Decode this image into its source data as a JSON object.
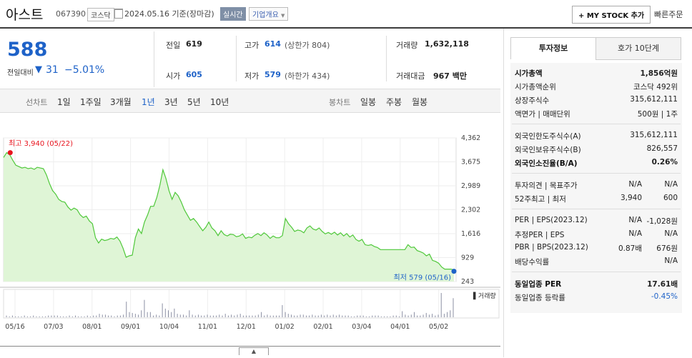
{
  "header": {
    "name": "아스트",
    "code": "067390",
    "market": "코스닥",
    "date_text": "2024.05.16 기준(장마감)",
    "realtime": "실시간",
    "company_overview": "기업개요",
    "my_stock_label": "+ MY STOCK 추가",
    "quick_order": "빠른주문"
  },
  "price": {
    "current": "588",
    "change_label": "전일대비",
    "change_arrow": "▼",
    "change_value": "31",
    "change_pct": "−5.01%"
  },
  "stats": {
    "prev_label": "전일",
    "prev": "619",
    "high_label": "고가",
    "high": "614",
    "upper_limit": "(상한가 804)",
    "volume_label": "거래량",
    "volume": "1,632,118",
    "open_label": "시가",
    "open": "605",
    "low_label": "저가",
    "low": "579",
    "lower_limit": "(하한가 434)",
    "amount_label": "거래대금",
    "amount": "967 백만"
  },
  "tabs": {
    "line_chart": "선차트",
    "periods": [
      "1일",
      "1주일",
      "3개월",
      "1년",
      "3년",
      "5년",
      "10년"
    ],
    "active_period": "1년",
    "candle_chart": "봉차트",
    "candle_periods": [
      "일봉",
      "주봉",
      "월봉"
    ]
  },
  "chart_data": {
    "type": "line",
    "y_ticks": [
      "4,362",
      "3,675",
      "2,989",
      "2,302",
      "1,616",
      "929",
      "243"
    ],
    "x_labels": [
      "05/16",
      "07/03",
      "08/01",
      "09/01",
      "10/04",
      "11/01",
      "12/01",
      "01/02",
      "02/01",
      "03/04",
      "04/01",
      "05/02"
    ],
    "max_label": "최고 3,940 (05/22)",
    "min_label": "최저 579 (05/16)",
    "volume_label": "거래량",
    "line_color": "#4fc83a",
    "fill_color": "#dff5d6",
    "ylim": [
      243,
      4362
    ],
    "values": [
      3800,
      3940,
      3880,
      3720,
      3580,
      3540,
      3500,
      3520,
      3480,
      3500,
      3460,
      3520,
      3500,
      3480,
      3300,
      3050,
      2850,
      2750,
      2600,
      2540,
      2520,
      2380,
      2290,
      2350,
      2300,
      2160,
      2080,
      2120,
      1980,
      1900,
      1500,
      1350,
      1460,
      1420,
      1440,
      1480,
      1460,
      1520,
      1400,
      1200,
      940,
      980,
      1000,
      1500,
      1750,
      1620,
      1950,
      2150,
      2400,
      2400,
      2650,
      3000,
      3450,
      3200,
      2850,
      2600,
      2800,
      2700,
      2520,
      2300,
      2150,
      2000,
      2050,
      1950,
      1820,
      1700,
      1800,
      1950,
      1780,
      1700,
      1560,
      1700,
      1590,
      1550,
      1600,
      1590,
      1530,
      1550,
      1610,
      1480,
      1520,
      1500,
      1570,
      1620,
      1560,
      1640,
      1580,
      1480,
      1550,
      1500,
      1500,
      1560,
      2050,
      1900,
      1800,
      1680,
      1720,
      1700,
      1640,
      1780,
      1840,
      1750,
      1720,
      1780,
      1680,
      1610,
      1650,
      1600,
      1660,
      1580,
      1640,
      1550,
      1620,
      1520,
      1580,
      1450,
      1400,
      1450,
      1300,
      1280,
      1300,
      1250,
      1220,
      1160,
      1160,
      1160,
      1160,
      1160,
      1160,
      1160,
      1160,
      1160,
      1300,
      1220,
      1230,
      1130,
      1100,
      1060,
      980,
      1030,
      850,
      820,
      770,
      660,
      600,
      600,
      600,
      579
    ]
  },
  "volume_data": {
    "values": [
      2,
      1,
      2,
      1,
      1,
      1,
      2,
      1,
      1,
      2,
      1,
      1,
      1,
      1,
      2,
      2,
      2,
      2,
      1,
      1,
      1,
      2,
      1,
      2,
      1,
      1,
      1,
      2,
      1,
      2,
      2,
      4,
      3,
      3,
      2,
      2,
      1,
      2,
      2,
      3,
      18,
      6,
      5,
      4,
      3,
      8,
      20,
      6,
      6,
      2,
      3,
      2,
      16,
      10,
      8,
      6,
      10,
      4,
      3,
      3,
      2,
      8,
      3,
      2,
      3,
      2,
      2,
      3,
      2,
      2,
      2,
      3,
      2,
      4,
      2,
      3,
      2,
      3,
      4,
      2,
      2,
      2,
      2,
      2,
      3,
      6,
      2,
      3,
      2,
      2,
      2,
      2,
      14,
      6,
      4,
      3,
      2,
      2,
      3,
      3,
      2,
      2,
      3,
      2,
      2,
      3,
      2,
      3,
      2,
      3,
      2,
      3,
      2,
      2,
      2,
      1,
      1,
      2,
      2,
      2,
      1,
      1,
      2,
      2,
      2,
      1,
      1,
      1,
      1,
      2,
      2,
      1,
      7,
      3,
      2,
      3,
      6,
      2,
      2,
      3,
      5,
      3,
      4,
      2,
      3,
      28,
      4,
      6,
      8,
      22
    ]
  },
  "info": {
    "tab_active": "투자정보",
    "tab_other": "호가 10단계",
    "rows1": [
      {
        "label": "시가총액",
        "value": "1,856억원"
      },
      {
        "label": "시가총액순위",
        "value": "코스닥 492위"
      },
      {
        "label": "상장주식수",
        "value": "315,612,111"
      },
      {
        "label": "액면가 | 매매단위",
        "value": "500원 | 1주"
      }
    ],
    "rows2": [
      {
        "label": "외국인한도주식수(A)",
        "value": "315,612,111"
      },
      {
        "label": "외국인보유주식수(B)",
        "value": "826,557"
      },
      {
        "label": "외국인소진율(B/A)",
        "value": "0.26%"
      }
    ],
    "rows3": [
      {
        "label": "투자의견 | 목표주가",
        "v1": "N/A",
        "v2": "N/A"
      },
      {
        "label": "52주최고 | 최저",
        "v1": "3,940",
        "v2": "600"
      }
    ],
    "rows4": [
      {
        "label": "PER | EPS(2023.12)",
        "v1": "N/A",
        "v2": "-1,028원"
      },
      {
        "label": "추정PER | EPS",
        "v1": "N/A",
        "v2": "N/A"
      },
      {
        "label": "PBR | BPS(2023.12)",
        "v1": "0.87배",
        "v2": "676원"
      },
      {
        "label": "배당수익률",
        "v1": "",
        "v2": "N/A"
      }
    ],
    "rows5": [
      {
        "label": "동일업종 PER",
        "value": "17.61배"
      },
      {
        "label": "동일업종 등락률",
        "value": "-0.45%"
      }
    ]
  }
}
